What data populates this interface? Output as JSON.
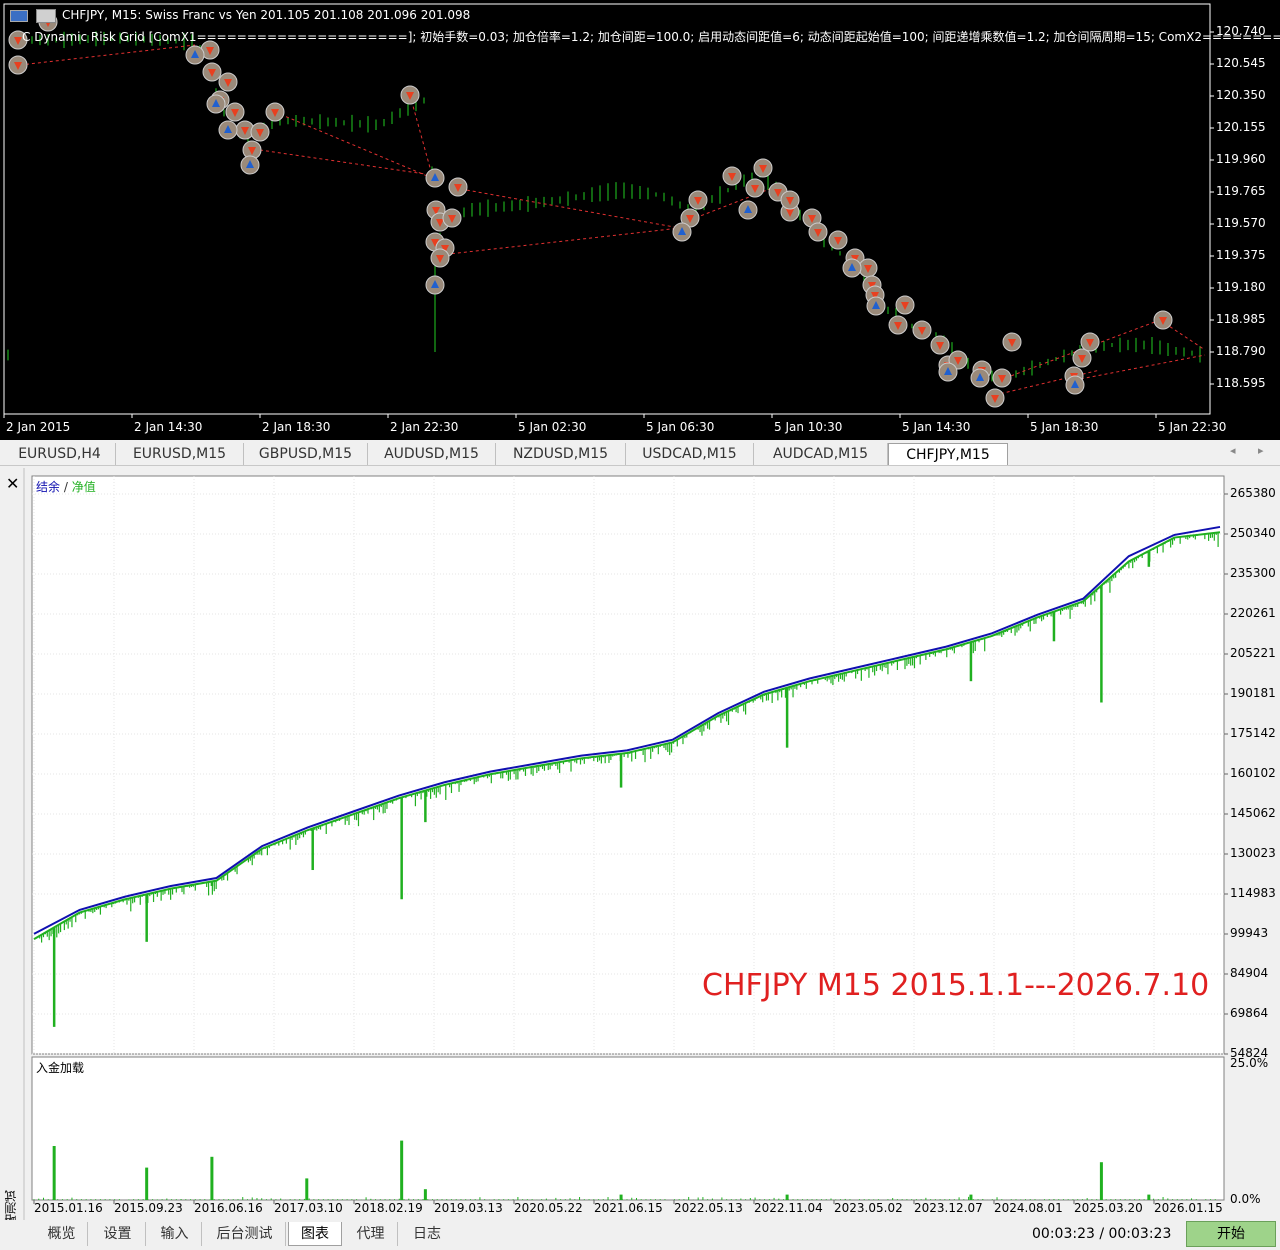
{
  "chart_window": {
    "title": "CHFJPY, M15:  Swiss Franc vs Yen  201.105 201.108 201.096 201.098",
    "indicator_text": "C Dynamic Risk Grid [ComX1=====================]; 初始手数=0.03; 加仓倍率=1.2; 加仓间距=100.0; 启用动态间距值=6; 动态间距起始值=100; 间距递增乘数值=1.2; 加仓间隔周期=15; ComX2========",
    "price_labels": [
      "120.740",
      "120.545",
      "120.350",
      "120.155",
      "119.960",
      "119.765",
      "119.570",
      "119.375",
      "119.180",
      "118.985",
      "118.790",
      "118.595"
    ],
    "time_labels": [
      "2 Jan 2015",
      "2 Jan 14:30",
      "2 Jan 18:30",
      "2 Jan 22:30",
      "5 Jan 02:30",
      "5 Jan 06:30",
      "5 Jan 10:30",
      "5 Jan 14:30",
      "5 Jan 18:30",
      "5 Jan 22:30"
    ],
    "bar_color": "#22cc22"
  },
  "symbol_tabs": [
    "EURUSD,H4",
    "EURUSD,M15",
    "GBPUSD,M15",
    "AUDUSD,M15",
    "NZDUSD,M15",
    "USDCAD,M15",
    "AUDCAD,M15",
    "CHFJPY,M15"
  ],
  "active_symbol_tab": "CHFJPY,M15",
  "tester": {
    "close_label": "✕",
    "legend_balance": "结余",
    "legend_sep": " / ",
    "legend_equity": "净值",
    "watermark": "CHFJPY M15 2015.1.1---2026.7.10",
    "watermark_color": "#e02020",
    "balance_color": "#1010b0",
    "equity_color": "#20b020",
    "deposit_label": "入金加载",
    "deposit_pct_top": "25.0%",
    "deposit_pct_bottom": "0.0%",
    "side_label": "策略测试",
    "timer": "00:03:23 / 00:03:23",
    "start_button": "开始"
  },
  "bottom_tabs": [
    "概览",
    "设置",
    "输入",
    "后台测试",
    "图表",
    "代理",
    "日志"
  ],
  "active_bottom_tab": "图表",
  "chart_data": {
    "type": "line",
    "title": "CHFJPY M15 2015.1.1---2026.7.10",
    "x_tick_labels": [
      "2015.01.16",
      "2015.09.23",
      "2016.06.16",
      "2017.03.10",
      "2018.02.19",
      "2019.03.13",
      "2020.05.22",
      "2021.06.15",
      "2022.05.13",
      "2022.11.04",
      "2023.05.02",
      "2023.12.07",
      "2024.08.01",
      "2025.03.20",
      "2026.01.15"
    ],
    "y_tick_labels": [
      "265380",
      "250340",
      "235300",
      "220261",
      "205221",
      "190181",
      "175142",
      "160102",
      "145062",
      "130023",
      "114983",
      "99943",
      "84904",
      "69864",
      "54824"
    ],
    "ylim": [
      54824,
      265380
    ],
    "legend": [
      "结余",
      "净值"
    ],
    "series": [
      {
        "name": "结余",
        "values": [
          100000,
          109000,
          114000,
          118000,
          121000,
          133000,
          140000,
          146000,
          152000,
          157000,
          161000,
          164000,
          167000,
          169000,
          173000,
          183000,
          191000,
          196000,
          200000,
          204000,
          208000,
          213000,
          220000,
          226000,
          242000,
          250000,
          253000
        ]
      },
      {
        "name": "净值",
        "values": [
          98000,
          108000,
          113000,
          117000,
          120000,
          132000,
          139000,
          145000,
          151000,
          156000,
          160000,
          163000,
          166000,
          168000,
          172000,
          182000,
          190000,
          195000,
          199000,
          203000,
          207000,
          212000,
          219000,
          225000,
          240000,
          249000,
          251000
        ]
      }
    ],
    "equity_dips": [
      [
        0.017,
        65000
      ],
      [
        0.095,
        97000
      ],
      [
        0.15,
        118000
      ],
      [
        0.235,
        124000
      ],
      [
        0.31,
        113000
      ],
      [
        0.33,
        142000
      ],
      [
        0.495,
        155000
      ],
      [
        0.635,
        170000
      ],
      [
        0.79,
        195000
      ],
      [
        0.86,
        210000
      ],
      [
        0.9,
        187000
      ],
      [
        0.94,
        238000
      ]
    ],
    "deposit_load": {
      "ylim": [
        0,
        25
      ],
      "spikes": [
        [
          0.017,
          10
        ],
        [
          0.095,
          6
        ],
        [
          0.15,
          8
        ],
        [
          0.23,
          4
        ],
        [
          0.31,
          11
        ],
        [
          0.33,
          2
        ],
        [
          0.495,
          1
        ],
        [
          0.635,
          1
        ],
        [
          0.79,
          1
        ],
        [
          0.9,
          7
        ],
        [
          0.94,
          1
        ]
      ]
    }
  }
}
